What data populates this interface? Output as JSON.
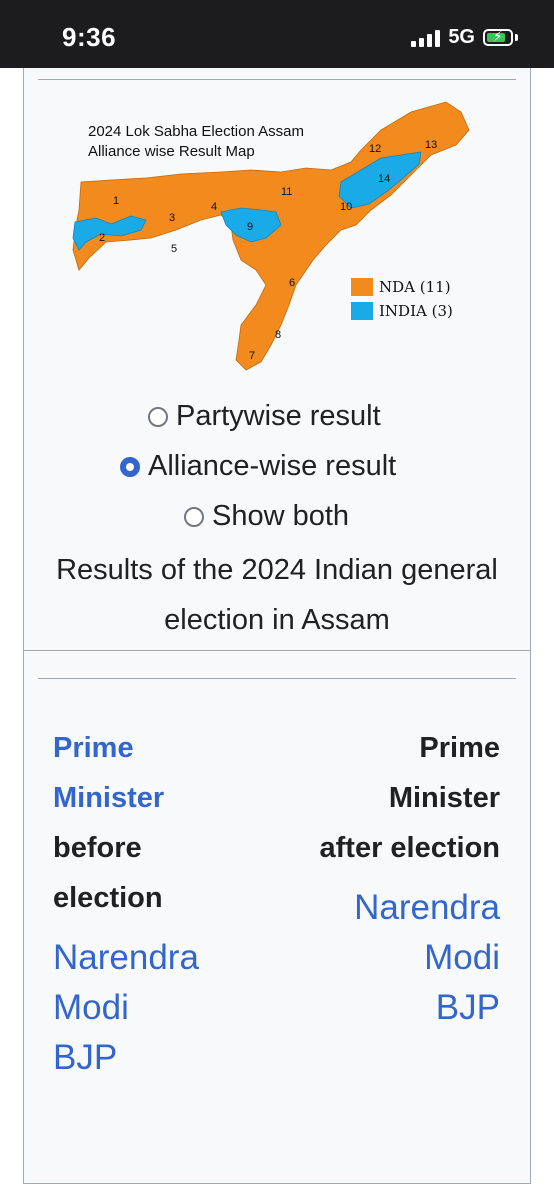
{
  "status_bar": {
    "time": "9:36",
    "network": "5G"
  },
  "map": {
    "title_line1": "2024 Lok Sabha Election Assam",
    "title_line2": "Alliance wise Result Map",
    "legend": [
      {
        "label": "NDA (11)",
        "color": "#f28a1e"
      },
      {
        "label": "INDIA (3)",
        "color": "#1aaae8"
      }
    ],
    "constituency_numbers": [
      "1",
      "2",
      "3",
      "4",
      "5",
      "6",
      "7",
      "8",
      "9",
      "10",
      "11",
      "12",
      "13",
      "14"
    ]
  },
  "options": {
    "partywise": "Partywise result",
    "alliance": "Alliance-wise result",
    "both": "Show both",
    "selected": "alliance"
  },
  "caption": "Results of the 2024 Indian general election in Assam",
  "pm_before": {
    "label_link_1": "Prime",
    "label_link_2": "Minister",
    "label_rest_1": "before",
    "label_rest_2": "election",
    "name_1": "Narendra",
    "name_2": "Modi",
    "party": "BJP"
  },
  "pm_after": {
    "label_1": "Prime",
    "label_2": "Minister",
    "label_3": "after election",
    "name_1": "Narendra",
    "name_2": "Modi",
    "party": "BJP"
  },
  "colors": {
    "nda": "#f28a1e",
    "india": "#1aaae8",
    "link": "#3366cc"
  }
}
